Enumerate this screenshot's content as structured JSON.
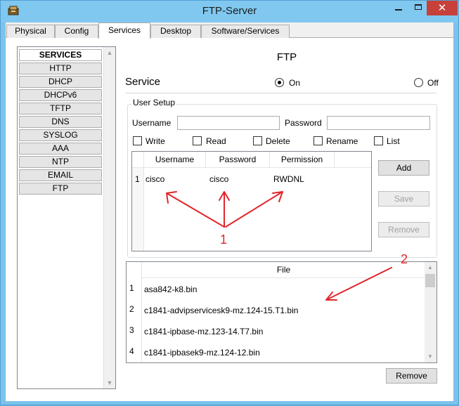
{
  "window": {
    "title": "FTP-Server",
    "close_glyph": "✕",
    "icon": "packet-tracer-server-icon"
  },
  "tabs": [
    "Physical",
    "Config",
    "Services",
    "Desktop",
    "Software/Services"
  ],
  "active_tab": "Services",
  "sidebar": {
    "header": "SERVICES",
    "items": [
      "HTTP",
      "DHCP",
      "DHCPv6",
      "TFTP",
      "DNS",
      "SYSLOG",
      "AAA",
      "NTP",
      "EMAIL",
      "FTP"
    ]
  },
  "ftp": {
    "title": "FTP",
    "service_label": "Service",
    "on_label": "On",
    "off_label": "Off",
    "service_state": "On"
  },
  "user_setup": {
    "group_title": "User Setup",
    "username_label": "Username",
    "password_label": "Password",
    "username_value": "",
    "password_value": "",
    "permissions": [
      "Write",
      "Read",
      "Delete",
      "Rename",
      "List"
    ],
    "table_headers": [
      "Username",
      "Password",
      "Permission"
    ],
    "rows": [
      {
        "num": "1",
        "username": "cisco",
        "password": "cisco",
        "permission": "RWDNL"
      }
    ],
    "add_label": "Add",
    "save_label": "Save",
    "remove_label": "Remove"
  },
  "files": {
    "header": "File",
    "rows": [
      {
        "num": "1",
        "name": "asa842-k8.bin"
      },
      {
        "num": "2",
        "name": "c1841-advipservicesk9-mz.124-15.T1.bin"
      },
      {
        "num": "3",
        "name": "c1841-ipbase-mz.123-14.T7.bin"
      },
      {
        "num": "4",
        "name": "c1841-ipbasek9-mz.124-12.bin"
      }
    ],
    "remove_label": "Remove"
  },
  "annotations": {
    "label_1": "1",
    "label_2": "2",
    "color": "#e1262b"
  }
}
